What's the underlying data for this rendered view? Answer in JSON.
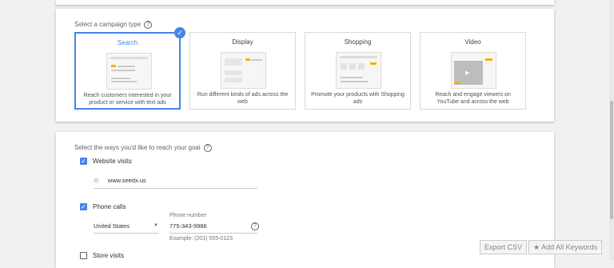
{
  "section1": {
    "title": "Select a campaign type",
    "help_icon": "?",
    "tiles": [
      {
        "name": "Search",
        "desc": "Reach customers interested in your product or service with text ads",
        "selected": true
      },
      {
        "name": "Display",
        "desc": "Run different kinds of ads across the web",
        "selected": false
      },
      {
        "name": "Shopping",
        "desc": "Promote your products with Shopping ads",
        "selected": false
      },
      {
        "name": "Video",
        "desc": "Reach and engage viewers on YouTube and across the web",
        "selected": false
      }
    ]
  },
  "section2": {
    "title": "Select the ways you'd like to reach your goal",
    "help_icon": "?",
    "website_visits": {
      "label": "Website visits",
      "checked": true,
      "url": "www.seedx.us",
      "icon": "link-icon"
    },
    "phone_calls": {
      "label": "Phone calls",
      "checked": true,
      "country": "United States",
      "phone_label": "Phone number",
      "phone_value": "775-343-9986",
      "example": "Example: (201) 555-0123"
    },
    "store_visits": {
      "label": "Store visits",
      "checked": false
    }
  },
  "buttons": {
    "export_csv": "Export CSV",
    "add_all": "Add All Keywords",
    "star_icon": "★"
  },
  "colors": {
    "accent": "#4a86e8",
    "background": "#f1f1f1"
  }
}
